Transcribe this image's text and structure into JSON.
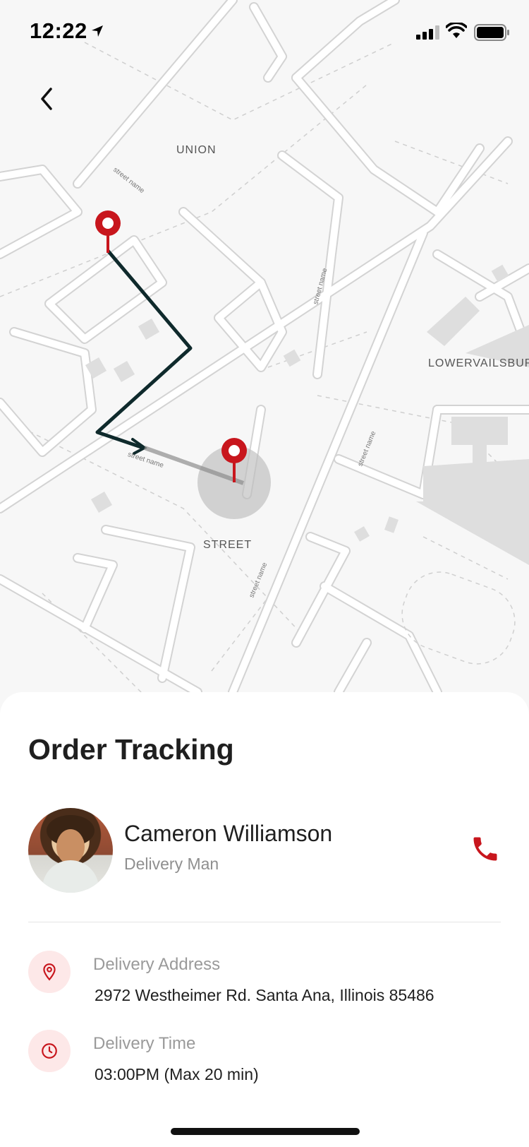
{
  "status_bar": {
    "time": "12:22",
    "icons": [
      "location-arrow-icon",
      "cellular-signal-icon",
      "wifi-icon",
      "battery-icon"
    ]
  },
  "map": {
    "labels": {
      "union": "UNION",
      "street": "STREET",
      "lowervailsburg": "LOWERVAILSBURG"
    },
    "street_name": "street name",
    "colors": {
      "route": "#0f2a2c",
      "pin": "#c8161d",
      "road_fill": "#ffffff",
      "road_outline": "#d3d3d3",
      "map_bg": "#f7f7f7"
    }
  },
  "order": {
    "title": "Order Tracking",
    "courier": {
      "name": "Cameron Williamson",
      "role": "Delivery Man"
    },
    "address": {
      "label": "Delivery Address",
      "value": "2972 Westheimer Rd. Santa Ana, Illinois 85486"
    },
    "time": {
      "label": "Delivery Time",
      "value": "03:00PM (Max 20 min)"
    }
  },
  "accent_color": "#c8161d"
}
